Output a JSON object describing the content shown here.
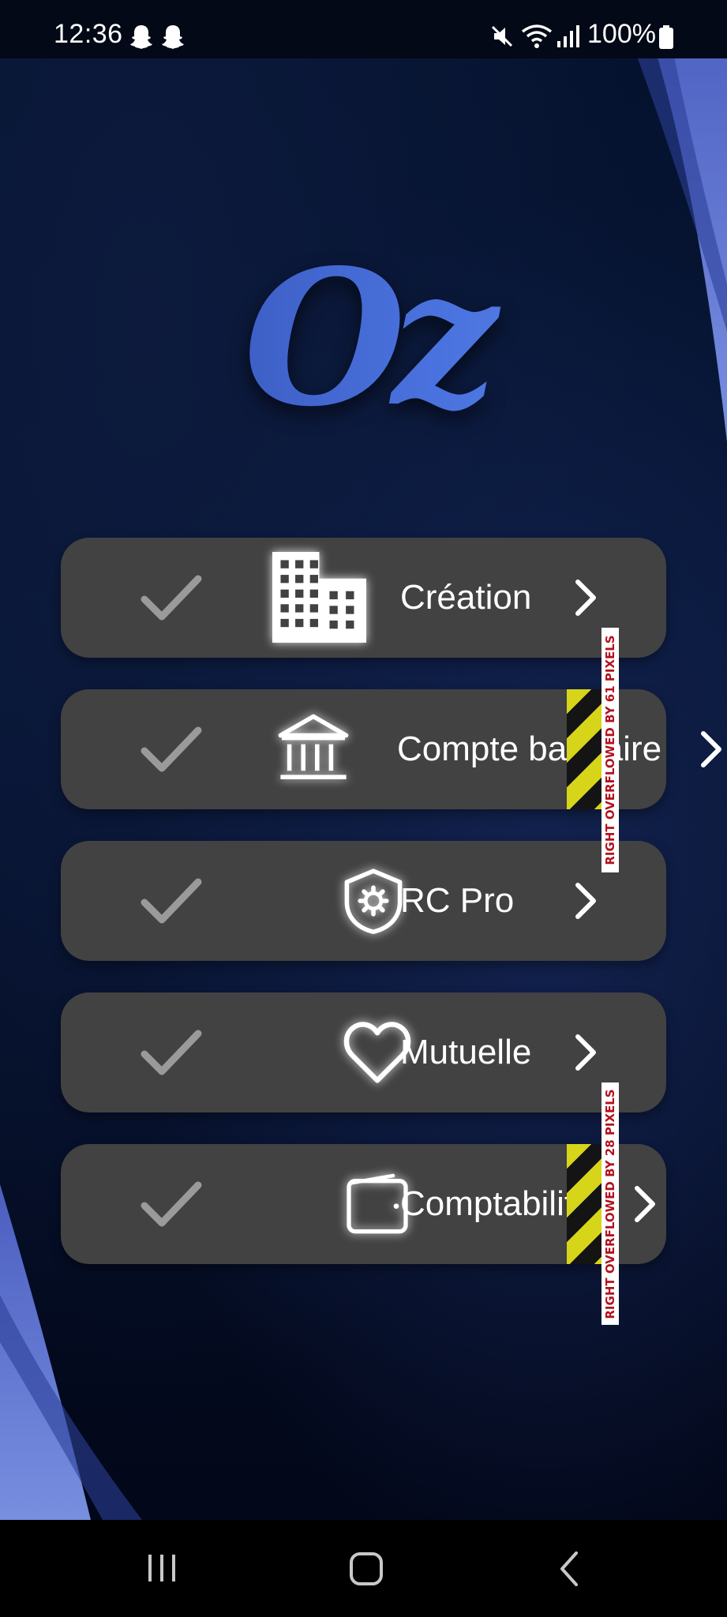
{
  "status_bar": {
    "time": "12:36",
    "battery": "100%",
    "icons": [
      "snapchat-icon",
      "snapchat-icon",
      "mute-icon",
      "wifi-icon",
      "signal-icon",
      "battery-icon"
    ]
  },
  "logo": {
    "text": "Oz"
  },
  "menu": {
    "items": [
      {
        "label": "Création",
        "icon": "building-icon",
        "checked": true
      },
      {
        "label": "Compte bancaire",
        "icon": "bank-icon",
        "checked": true
      },
      {
        "label": "RC Pro",
        "icon": "shield-icon",
        "checked": true
      },
      {
        "label": "Mutuelle",
        "icon": "heart-icon",
        "checked": true
      },
      {
        "label": "Comptabilité",
        "icon": "wallet-icon",
        "checked": true
      }
    ]
  },
  "debug_overflow": [
    {
      "text": "RIGHT OVERFLOWED BY 61 PIXELS"
    },
    {
      "text": "RIGHT OVERFLOWED BY 28 PIXELS"
    }
  ],
  "navigation_bar": {
    "buttons": [
      "recent-apps-icon",
      "home-icon",
      "back-icon"
    ]
  },
  "colors": {
    "background": "#04102a",
    "card": "#424243",
    "accent": "#4a72de",
    "text": "#ffffff",
    "check": "#9a9a9a"
  }
}
